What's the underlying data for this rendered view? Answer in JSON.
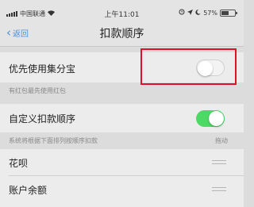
{
  "status_bar": {
    "carrier": "中国联通",
    "time": "上午11:01",
    "battery": "57%",
    "battery_level": 0.57
  },
  "nav": {
    "back_label": "返回",
    "title": "扣款顺序"
  },
  "settings": {
    "jijifenbao_label": "优先使用集分宝",
    "jijifenbao_enabled": false,
    "hongbao_note": "有红包最先使用红包",
    "custom_order_label": "自定义扣款顺序",
    "custom_order_enabled": true,
    "order_note": "系统将根据下面排列按顺序扣款",
    "drag_label": "拖动",
    "payment_methods": [
      "花呗",
      "账户余额"
    ]
  },
  "colors": {
    "toggle_on": "#4cd964",
    "highlight": "#e0102a",
    "link": "#4a90d9"
  }
}
